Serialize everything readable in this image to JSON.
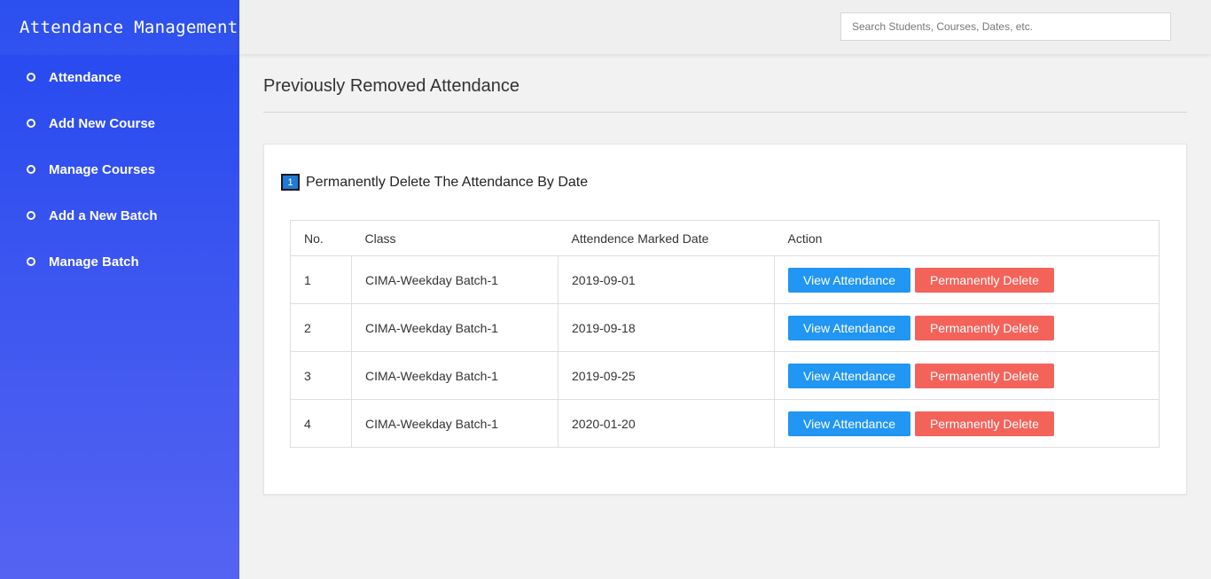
{
  "sidebar": {
    "brand": "Attendance Management",
    "items": [
      {
        "label": "Attendance"
      },
      {
        "label": "Add New Course"
      },
      {
        "label": "Manage Courses"
      },
      {
        "label": "Add a New Batch"
      },
      {
        "label": "Manage Batch"
      }
    ]
  },
  "topbar": {
    "search_placeholder": "Search Students, Courses, Dates, etc."
  },
  "page": {
    "title": "Previously Removed Attendance"
  },
  "card": {
    "badge": "1",
    "title": "Permanently Delete The Attendance By Date",
    "table": {
      "headers": [
        "No.",
        "Class",
        "Attendence Marked Date",
        "Action"
      ],
      "rows": [
        {
          "no": "1",
          "class": "CIMA-Weekday Batch-1",
          "date": "2019-09-01"
        },
        {
          "no": "2",
          "class": "CIMA-Weekday Batch-1",
          "date": "2019-09-18"
        },
        {
          "no": "3",
          "class": "CIMA-Weekday Batch-1",
          "date": "2019-09-25"
        },
        {
          "no": "4",
          "class": "CIMA-Weekday Batch-1",
          "date": "2020-01-20"
        }
      ],
      "view_label": "View Attendance",
      "delete_label": "Permanently Delete"
    }
  },
  "colors": {
    "sidebar_top": "#2448ef",
    "sidebar_bottom": "#5563f2",
    "view_button": "#2196f3",
    "delete_button": "#f4635a",
    "badge": "#1f7ad8"
  }
}
